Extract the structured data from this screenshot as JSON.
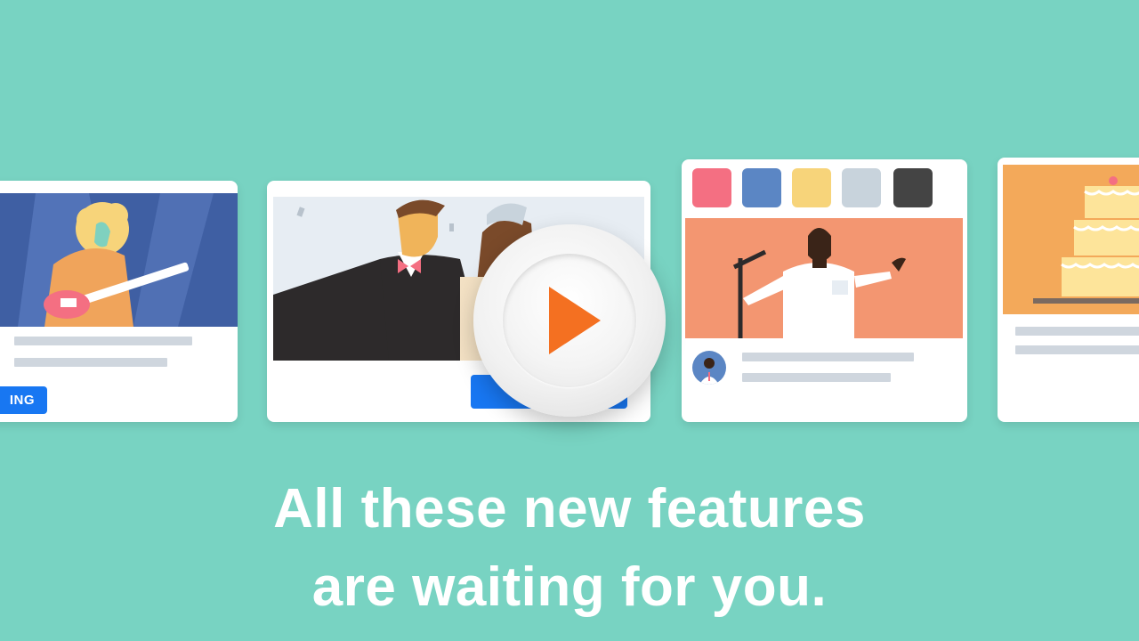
{
  "cards": {
    "concert": {
      "button_label": "ING"
    },
    "wedding": {
      "button_label": ""
    },
    "speaker": {
      "swatches": [
        "#f46f82",
        "#5b86c4",
        "#f7d47a",
        "#c8d3dc",
        "#444444"
      ]
    },
    "cake": {}
  },
  "play_button": {
    "icon": "play-icon",
    "color": "#f47021"
  },
  "caption": {
    "line1": "All these new features",
    "line2": "are waiting for you."
  },
  "colors": {
    "background": "#78d3c2",
    "card": "#ffffff",
    "placeholder_bar": "#cfd6de",
    "accent_blue": "#1877f2"
  }
}
